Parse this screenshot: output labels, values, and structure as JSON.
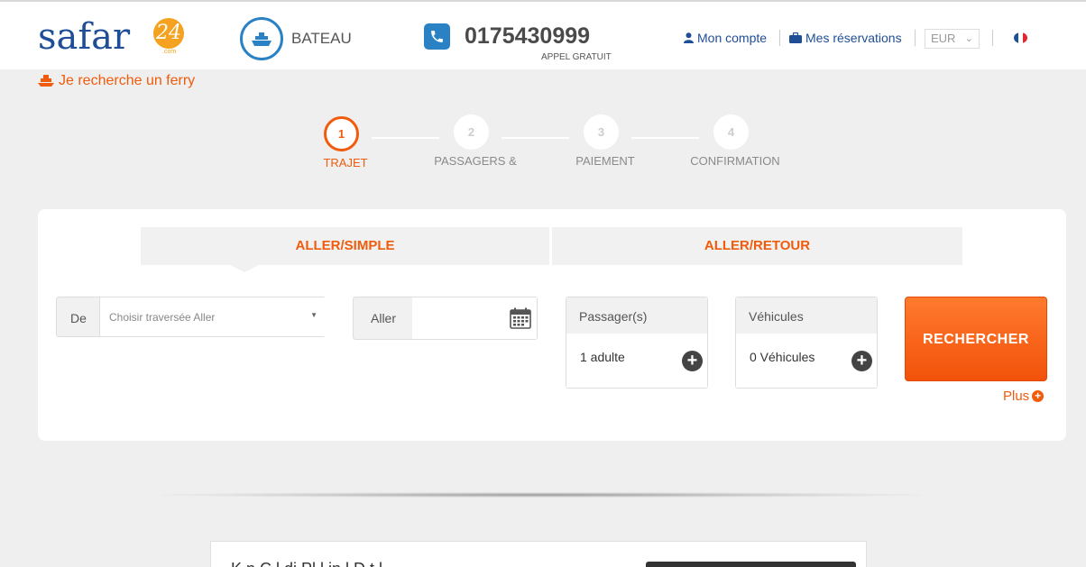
{
  "header": {
    "logo_text": "safar",
    "logo_badge": "24",
    "logo_sub": ".com",
    "service_label": "BATEAU",
    "phone_number": "0175430999",
    "phone_note": "APPEL GRATUIT",
    "account_label": "Mon compte",
    "reservations_label": "Mes réservations",
    "currency": "EUR",
    "language_flag": "fr"
  },
  "ferry_link": "Je recherche un ferry",
  "steps": [
    {
      "number": "1",
      "label": "TRAJET",
      "active": true
    },
    {
      "number": "2",
      "label": "PASSAGERS &",
      "active": false
    },
    {
      "number": "3",
      "label": "PAIEMENT",
      "active": false
    },
    {
      "number": "4",
      "label": "CONFIRMATION",
      "active": false
    }
  ],
  "search": {
    "tab_oneway": "ALLER/SIMPLE",
    "tab_return": "ALLER/RETOUR",
    "from_label": "De",
    "from_placeholder": "Choisir traversée Aller",
    "date_label": "Aller",
    "date_value": "",
    "passengers_label": "Passager(s)",
    "passengers_value": "1 adulte",
    "vehicles_label": "Véhicules",
    "vehicles_value": "0 Véhicules",
    "search_button": "RECHERCHER",
    "more_label": "Plus"
  },
  "colors": {
    "accent": "#f05b0c",
    "brand_blue": "#1f4e96",
    "link_blue": "#2a82c5"
  },
  "bottom": {
    "heading": "K     n  C  l  di Pl  l      in  l     D     t l"
  }
}
